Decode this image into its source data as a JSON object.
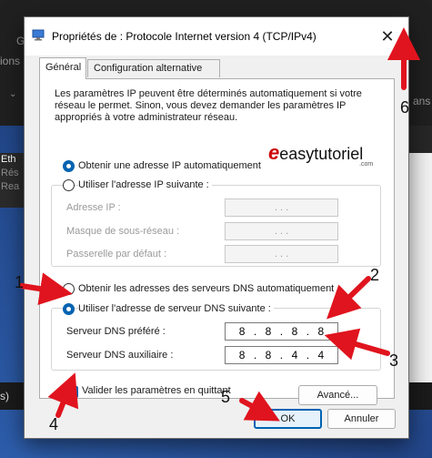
{
  "background": {
    "top_fragment_left": "ions",
    "top_fragment_left2": "G",
    "top_fragment_right": "ans",
    "list_items": [
      "Eth",
      "Rés",
      "Rea"
    ],
    "bottom_fragment": "s)"
  },
  "dialog": {
    "title": "Propriétés de : Protocole Internet version 4 (TCP/IPv4)",
    "close_glyph": "✕",
    "tabs": [
      {
        "label": "Général",
        "active": true
      },
      {
        "label": "Configuration alternative",
        "active": false
      }
    ],
    "intro": "Les paramètres IP peuvent être déterminés automatiquement si votre réseau le permet. Sinon, vous devez demander les paramètres IP appropriés à votre administrateur réseau.",
    "ip_auto_label": "Obtenir une adresse IP automatiquement",
    "ip_manual_label": "Utiliser l'adresse IP suivante :",
    "ip_auto_selected": true,
    "ip_fields": [
      {
        "label": "Adresse IP :",
        "value": ". . ."
      },
      {
        "label": "Masque de sous-réseau :",
        "value": ". . ."
      },
      {
        "label": "Passerelle par défaut :",
        "value": ". . ."
      }
    ],
    "dns_auto_label": "Obtenir les adresses des serveurs DNS automatiquement",
    "dns_manual_label": "Utiliser l'adresse de serveur DNS suivante :",
    "dns_manual_selected": true,
    "dns_fields": [
      {
        "label": "Serveur DNS préféré :",
        "octets": [
          "8",
          "8",
          "8",
          "8"
        ]
      },
      {
        "label": "Serveur DNS auxiliaire :",
        "octets": [
          "8",
          "8",
          "4",
          "4"
        ]
      }
    ],
    "validate_label": "Valider les paramètres en quittant",
    "validate_checked": true,
    "advanced_label": "Avancé...",
    "ok_label": "OK",
    "cancel_label": "Annuler"
  },
  "watermark": {
    "e": "e",
    "text": "easytutoriel",
    "com": ".com"
  },
  "annotations": {
    "numbers": [
      "1",
      "2",
      "3",
      "4",
      "5",
      "6"
    ],
    "arrow_color": "#e0141e"
  }
}
